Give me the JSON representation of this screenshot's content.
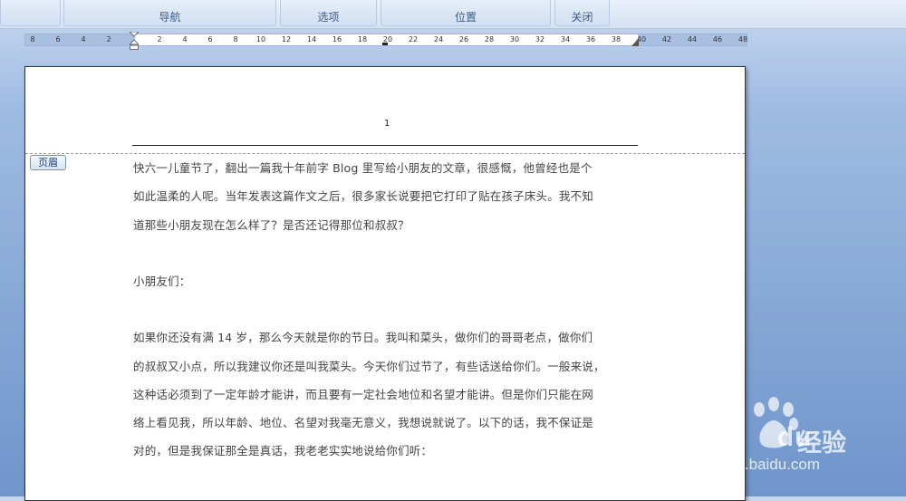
{
  "ribbon": {
    "groups": [
      {
        "label": ""
      },
      {
        "label": "导航"
      },
      {
        "label": "选项"
      },
      {
        "label": "位置"
      },
      {
        "label": "关闭"
      }
    ]
  },
  "ruler": {
    "left_ticks": [
      "8",
      "6",
      "4",
      "2"
    ],
    "right_ticks": [
      "2",
      "4",
      "6",
      "8",
      "10",
      "12",
      "14",
      "16",
      "18",
      "20",
      "22",
      "24",
      "26",
      "28",
      "30",
      "32",
      "34",
      "36",
      "38",
      "40",
      "42",
      "44",
      "46",
      "48"
    ]
  },
  "header": {
    "page_number": "1",
    "tag_label": "页眉"
  },
  "body": {
    "p1_l1": "快六一儿童节了，翻出一篇我十年前字 Blog 里写给小朋友的文章，很感慨，他曾经也是个",
    "p1_l2": "如此温柔的人呢。当年发表这篇作文之后，很多家长说要把它打印了贴在孩子床头。我不知",
    "p1_l3": "道那些小朋友现在怎么样了？是否还记得那位和叔叔？",
    "p2": "小朋友们：",
    "p3_l1": "如果你还没有满 14 岁，那么今天就是你的节日。我叫和菜头，做你们的哥哥老点，做你们",
    "p3_l2": "的叔叔又小点，所以我建议你还是叫我菜头。今天你们过节了，有些话送给你们。一般来说，",
    "p3_l3": "这种话必须到了一定年龄才能讲，而且要有一定社会地位和名望才能讲。但是你们只能在网",
    "p3_l4": "络上看见我，所以年龄、地位、名望对我毫无意义，我想说就说了。以下的话，我不保证是",
    "p3_l5": "对的，但是我保证那全是真话，我老老实实地说给你们听："
  },
  "watermark": {
    "brand": "Bai",
    "brand2": "du",
    "jingyan": "经验",
    "url": "jingyan.baidu.com"
  }
}
